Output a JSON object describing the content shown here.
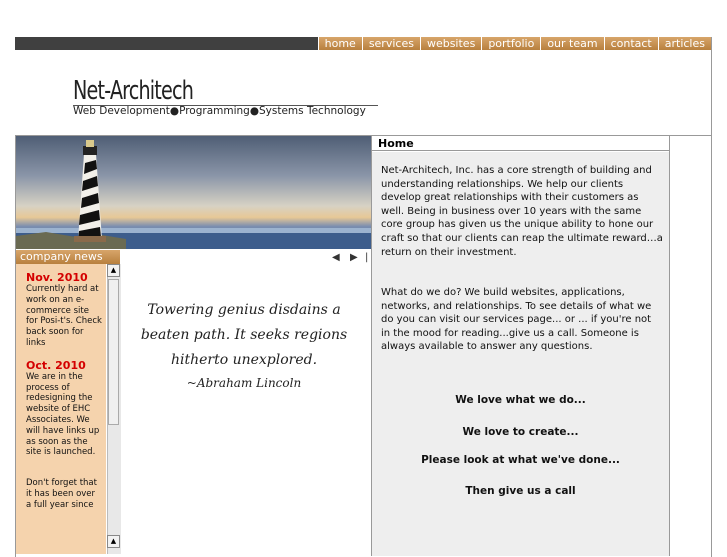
{
  "nav": {
    "items": [
      "home",
      "services",
      "websites",
      "portfolio",
      "our team",
      "contact",
      "articles"
    ]
  },
  "header": {
    "title": "Net-Architech",
    "subtitle": "Web Development●Programming●Systems Technology"
  },
  "slideshow": {
    "prev": "◀",
    "next": "▶",
    "separator": "|"
  },
  "news": {
    "heading": "company news",
    "items": [
      {
        "date": "Nov. 2010",
        "text": "Currently hard at work on an e-commerce site for Posi-t's. Check back soon for links"
      },
      {
        "date": "Oct. 2010",
        "text": "We are in the process of redesigning the website of EHC Associates. We will have links up as soon as the site is launched."
      },
      {
        "date": "",
        "text": "Don't forget that it has been over a full year since"
      }
    ]
  },
  "quote": {
    "line1": "Towering genius disdains a",
    "line2": "beaten path. It seeks regions",
    "line3": "hitherto unexplored.",
    "author": "~Abraham Lincoln"
  },
  "main": {
    "heading": "Home",
    "para1": "Net-Architech, Inc. has a core strength of building and understanding relationships. We help our clients develop great relationships with their customers as well. Being in business over 10 years with the same core group has given us the unique ability to hone our craft so that our clients can reap the ultimate reward…a return on their investment.",
    "para2": "What do we do? We build websites, applications, networks, and relationships. To see details of what we do you can visit our services page... or ... if you're not in the mood for reading...give us a call. Someone is always available to answer any questions.",
    "taglines": [
      "We love what we do...",
      "We love to create...",
      "Please look at what we've done...",
      "Then give us a call"
    ]
  },
  "colors": {
    "accent": "#c8914f",
    "news_bg": "#f5d3ad",
    "news_date": "#d40000",
    "topbar": "#404040"
  }
}
